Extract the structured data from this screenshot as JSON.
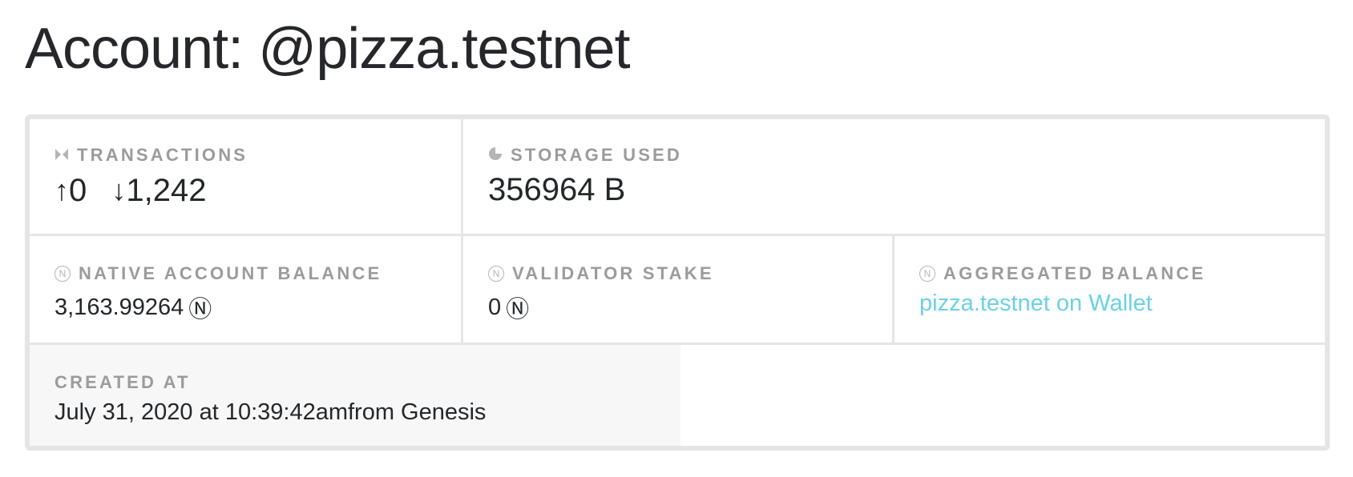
{
  "page": {
    "title": "Account: @pizza.testnet"
  },
  "card": {
    "transactions": {
      "label": "TRANSACTIONS",
      "icon": "transactions-icon",
      "sent_arrow": "↑",
      "sent": "0",
      "received_arrow": "↓",
      "received": "1,242"
    },
    "storage": {
      "label": "STORAGE USED",
      "icon": "pie-icon",
      "value": "356964 B"
    },
    "native_balance": {
      "label": "NATIVE ACCOUNT BALANCE",
      "icon": "near-icon",
      "value": "3,163.99264",
      "unit": "Ⓝ"
    },
    "validator_stake": {
      "label": "VALIDATOR STAKE",
      "icon": "near-icon",
      "value": "0",
      "unit": "Ⓝ"
    },
    "aggregated_balance": {
      "label": "AGGREGATED BALANCE",
      "icon": "near-icon",
      "link_text": "pizza.testnet on Wallet",
      "link_color": "#6ad1e3"
    },
    "created_at": {
      "label": "CREATED AT",
      "value": "July 31, 2020 at 10:39:42amfrom Genesis"
    }
  },
  "colors": {
    "border": "#e5e5e5",
    "label": "#9b9b9b",
    "text": "#24272a",
    "created_bg": "#f7f7f7"
  }
}
